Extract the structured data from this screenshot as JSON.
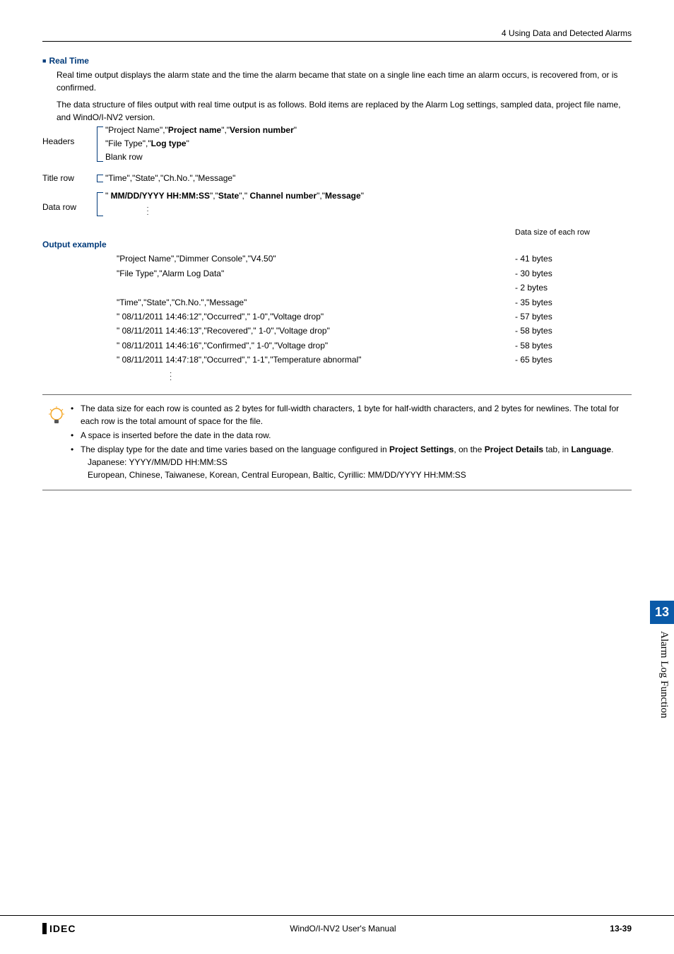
{
  "header": {
    "breadcrumb": "4 Using Data and Detected Alarms"
  },
  "section": {
    "title": "Real Time",
    "para1": "Real time output displays the alarm state and the time the alarm became that state on a single line each time an alarm occurs, is recovered from, or is confirmed.",
    "para2": "The data structure of files output with real time output is as follows. Bold items are replaced by the Alarm Log settings, sampled data, project file name, and WindO/I-NV2 version."
  },
  "structure": {
    "headers_label": "Headers",
    "headers_lines": {
      "l1_pre": "\"Project Name\",\"",
      "l1_b1": "Project name",
      "l1_mid": "\",\"",
      "l1_b2": "Version number",
      "l1_post": "\"",
      "l2_pre": "\"File Type\",\"",
      "l2_b1": "Log type",
      "l2_post": "\"",
      "l3": "Blank row"
    },
    "title_label": "Title row",
    "title_line": "\"Time\",\"State\",\"Ch.No.\",\"Message\"",
    "data_label": "Data row",
    "data_line": {
      "pre": "\" ",
      "b1": "MM/DD/YYYY HH:MM:SS",
      "m1": "\",\"",
      "b2": "State",
      "m2": "\",\" ",
      "b3": "Channel number",
      "m3": "\",\"",
      "b4": "Message",
      "post": "\""
    }
  },
  "output": {
    "heading": "Output example",
    "size_label": "Data size of each row",
    "rows": [
      {
        "text": "\"Project Name\",\"Dimmer Console\",\"V4.50\"",
        "size": "- 41 bytes"
      },
      {
        "text": "\"File Type\",\"Alarm Log Data\"",
        "size": "- 30 bytes"
      },
      {
        "text": "",
        "size": "- 2 bytes"
      },
      {
        "text": "\"Time\",\"State\",\"Ch.No.\",\"Message\"",
        "size": "- 35 bytes"
      },
      {
        "text": "\" 08/11/2011 14:46:12\",\"Occurred\",\" 1-0\",\"Voltage drop\"",
        "size": "- 57 bytes"
      },
      {
        "text": "\" 08/11/2011 14:46:13\",\"Recovered\",\" 1-0\",\"Voltage drop\"",
        "size": "- 58 bytes"
      },
      {
        "text": "\" 08/11/2011 14:46:16\",\"Confirmed\",\" 1-0\",\"Voltage drop\"",
        "size": "- 58 bytes"
      },
      {
        "text": "\" 08/11/2011 14:47:18\",\"Occurred\",\" 1-1\",\"Temperature abnormal\"",
        "size": "- 65 bytes"
      }
    ]
  },
  "notes": {
    "n1": "The data size for each row is counted as 2 bytes for full-width characters, 1 byte for half-width characters, and 2 bytes for newlines. The total for each row is the total amount of space for the file.",
    "n2": "A space is inserted before the date in the data row.",
    "n3_pre": "The display type for the date and time varies based on the language configured in ",
    "n3_b1": "Project Settings",
    "n3_mid": ", on the ",
    "n3_b2": "Project Details",
    "n3_mid2": " tab, in ",
    "n3_b3": "Language",
    "n3_post": ".",
    "n3_sub1": "Japanese: YYYY/MM/DD HH:MM:SS",
    "n3_sub2": "European, Chinese, Taiwanese, Korean, Central European, Baltic, Cyrillic: MM/DD/YYYY HH:MM:SS"
  },
  "sidebar": {
    "chapter": "13",
    "title": "Alarm Log Function"
  },
  "footer": {
    "logo": "IDEC",
    "center": "WindO/I-NV2 User's Manual",
    "page": "13-39"
  }
}
